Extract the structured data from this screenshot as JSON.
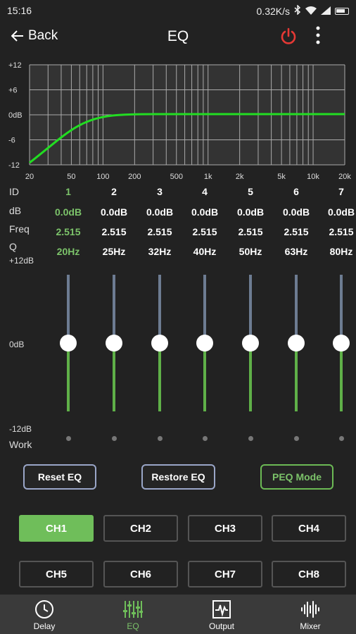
{
  "status": {
    "time": "15:16",
    "speed": "0.32K/s"
  },
  "appbar": {
    "back_label": "Back",
    "title": "EQ"
  },
  "graph": {
    "y_ticks": [
      "+12",
      "+6",
      "0dB",
      "-6",
      "-12"
    ],
    "x_ticks": [
      "20",
      "50",
      "100",
      "200",
      "500",
      "1k",
      "2k",
      "5k",
      "10k",
      "20k"
    ]
  },
  "labels": {
    "id": "ID",
    "db": "dB",
    "freq": "Freq",
    "q": "Q",
    "plus12": "+12dB",
    "zero": "0dB",
    "minus12": "-12dB",
    "work": "Work"
  },
  "bands": [
    {
      "id": "1",
      "db": "0.0dB",
      "q": "2.515",
      "freq": "20Hz",
      "level": 0.5
    },
    {
      "id": "2",
      "db": "0.0dB",
      "q": "2.515",
      "freq": "25Hz",
      "level": 0.5
    },
    {
      "id": "3",
      "db": "0.0dB",
      "q": "2.515",
      "freq": "32Hz",
      "level": 0.5
    },
    {
      "id": "4",
      "db": "0.0dB",
      "q": "2.515",
      "freq": "40Hz",
      "level": 0.5
    },
    {
      "id": "5",
      "db": "0.0dB",
      "q": "2.515",
      "freq": "50Hz",
      "level": 0.5
    },
    {
      "id": "6",
      "db": "0.0dB",
      "q": "2.515",
      "freq": "63Hz",
      "level": 0.5
    },
    {
      "id": "7",
      "db": "0.0dB",
      "q": "2.515",
      "freq": "80Hz",
      "level": 0.5
    }
  ],
  "buttons": {
    "reset": "Reset EQ",
    "restore": "Restore EQ",
    "peq": "PEQ Mode"
  },
  "channels": [
    "CH1",
    "CH2",
    "CH3",
    "CH4",
    "CH5",
    "CH6",
    "CH7",
    "CH8"
  ],
  "active_channel": "CH1",
  "nav": [
    {
      "label": "Delay",
      "icon": "clock-icon"
    },
    {
      "label": "EQ",
      "icon": "eq-sliders-icon",
      "active": true
    },
    {
      "label": "Output",
      "icon": "waveform-box-icon"
    },
    {
      "label": "Mixer",
      "icon": "audio-wave-icon"
    }
  ],
  "colors": {
    "accent": "#6fbe5a",
    "background": "#222222",
    "power": "#e53935"
  }
}
